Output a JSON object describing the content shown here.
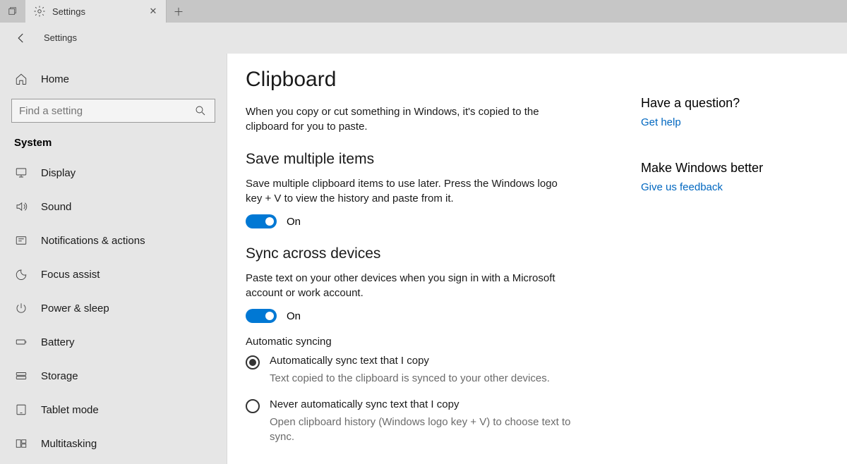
{
  "tab": {
    "title": "Settings"
  },
  "header": {
    "title": "Settings"
  },
  "sidebar": {
    "home": "Home",
    "search_placeholder": "Find a setting",
    "group_label": "System",
    "items": [
      {
        "icon": "display",
        "label": "Display"
      },
      {
        "icon": "sound",
        "label": "Sound"
      },
      {
        "icon": "notify",
        "label": "Notifications & actions"
      },
      {
        "icon": "focus",
        "label": "Focus assist"
      },
      {
        "icon": "power",
        "label": "Power & sleep"
      },
      {
        "icon": "battery",
        "label": "Battery"
      },
      {
        "icon": "storage",
        "label": "Storage"
      },
      {
        "icon": "tablet",
        "label": "Tablet mode"
      },
      {
        "icon": "multi",
        "label": "Multitasking"
      }
    ]
  },
  "main": {
    "title": "Clipboard",
    "intro": "When you copy or cut something in Windows, it's copied to the clipboard for you to paste.",
    "section1": {
      "heading": "Save multiple items",
      "desc": "Save multiple clipboard items to use later. Press the Windows logo key + V to view the history and paste from it.",
      "toggle_state": "On"
    },
    "section2": {
      "heading": "Sync across devices",
      "desc": "Paste text on your other devices when you sign in with a Microsoft account or work account.",
      "toggle_state": "On",
      "subheading": "Automatic syncing",
      "options": [
        {
          "label": "Automatically sync text that I copy",
          "desc": "Text copied to the clipboard is synced to your other devices.",
          "checked": true
        },
        {
          "label": "Never automatically sync text that I copy",
          "desc": "Open clipboard history (Windows logo key + V) to choose text to sync.",
          "checked": false
        }
      ]
    }
  },
  "aside": {
    "q_heading": "Have a question?",
    "q_link": "Get help",
    "f_heading": "Make Windows better",
    "f_link": "Give us feedback"
  }
}
